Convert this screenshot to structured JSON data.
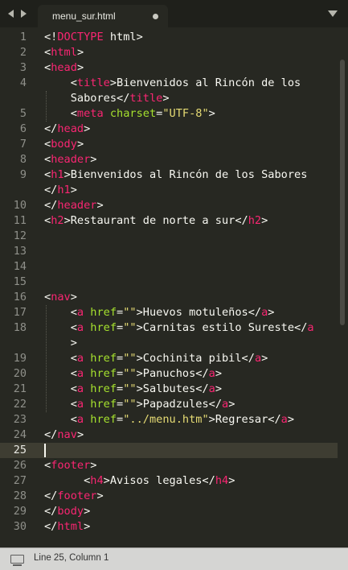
{
  "tab": {
    "filename": "menu_sur.html",
    "modified": true
  },
  "icons": {
    "nav_left": "arrow-left-icon",
    "nav_right": "arrow-right-icon",
    "tab_dirty": "unsaved-dot-icon",
    "dropdown": "chevron-down-icon",
    "status": "console-icon"
  },
  "colors": {
    "background": "#272822",
    "tag": "#f92672",
    "attribute": "#a6e22e",
    "string": "#e6db74",
    "text": "#f8f8f2",
    "line_highlight": "#3e3d32"
  },
  "editor": {
    "active_line": 25,
    "lines": [
      {
        "n": "1",
        "code": [
          [
            "t",
            "<!"
          ],
          [
            "k",
            "DOCTYPE"
          ],
          [
            "t",
            " html>"
          ]
        ]
      },
      {
        "n": "2",
        "code": [
          [
            "t",
            "<"
          ],
          [
            "k",
            "html"
          ],
          [
            "t",
            ">"
          ]
        ]
      },
      {
        "n": "3",
        "code": [
          [
            "t",
            "<"
          ],
          [
            "k",
            "head"
          ],
          [
            "t",
            ">"
          ]
        ]
      },
      {
        "n": "4",
        "code": [
          [
            "t",
            "    <"
          ],
          [
            "k",
            "title"
          ],
          [
            "t",
            ">Bienvenidos al Rincón de los"
          ]
        ]
      },
      {
        "n": "",
        "code": [
          [
            "t",
            "    Sabores</"
          ],
          [
            "k",
            "title"
          ],
          [
            "t",
            ">"
          ]
        ]
      },
      {
        "n": "5",
        "code": [
          [
            "t",
            "    <"
          ],
          [
            "k",
            "meta"
          ],
          [
            "t",
            " "
          ],
          [
            "a",
            "charset"
          ],
          [
            "t",
            "="
          ],
          [
            "s",
            "\"UTF-8\""
          ],
          [
            "t",
            ">"
          ]
        ]
      },
      {
        "n": "6",
        "code": [
          [
            "t",
            "</"
          ],
          [
            "k",
            "head"
          ],
          [
            "t",
            ">"
          ]
        ]
      },
      {
        "n": "7",
        "code": [
          [
            "t",
            "<"
          ],
          [
            "k",
            "body"
          ],
          [
            "t",
            ">"
          ]
        ]
      },
      {
        "n": "8",
        "code": [
          [
            "t",
            "<"
          ],
          [
            "k",
            "header"
          ],
          [
            "t",
            ">"
          ]
        ]
      },
      {
        "n": "9",
        "code": [
          [
            "t",
            "<"
          ],
          [
            "k",
            "h1"
          ],
          [
            "t",
            ">Bienvenidos al Rincón de los Sabores"
          ]
        ]
      },
      {
        "n": "",
        "code": [
          [
            "t",
            "</"
          ],
          [
            "k",
            "h1"
          ],
          [
            "t",
            ">"
          ]
        ]
      },
      {
        "n": "10",
        "code": [
          [
            "t",
            "</"
          ],
          [
            "k",
            "header"
          ],
          [
            "t",
            ">"
          ]
        ]
      },
      {
        "n": "11",
        "code": [
          [
            "t",
            "<"
          ],
          [
            "k",
            "h2"
          ],
          [
            "t",
            ">Restaurant de norte a sur</"
          ],
          [
            "k",
            "h2"
          ],
          [
            "t",
            ">"
          ]
        ]
      },
      {
        "n": "12",
        "code": []
      },
      {
        "n": "13",
        "code": []
      },
      {
        "n": "14",
        "code": []
      },
      {
        "n": "15",
        "code": []
      },
      {
        "n": "16",
        "code": [
          [
            "t",
            "<"
          ],
          [
            "k",
            "nav"
          ],
          [
            "t",
            ">"
          ]
        ]
      },
      {
        "n": "17",
        "code": [
          [
            "t",
            "    <"
          ],
          [
            "k",
            "a"
          ],
          [
            "t",
            " "
          ],
          [
            "a",
            "href"
          ],
          [
            "t",
            "="
          ],
          [
            "s",
            "\"\""
          ],
          [
            "t",
            ">Huevos motuleños</"
          ],
          [
            "k",
            "a"
          ],
          [
            "t",
            ">"
          ]
        ]
      },
      {
        "n": "18",
        "code": [
          [
            "t",
            "    <"
          ],
          [
            "k",
            "a"
          ],
          [
            "t",
            " "
          ],
          [
            "a",
            "href"
          ],
          [
            "t",
            "="
          ],
          [
            "s",
            "\"\""
          ],
          [
            "t",
            ">Carnitas estilo Sureste</"
          ],
          [
            "k",
            "a"
          ]
        ]
      },
      {
        "n": "",
        "code": [
          [
            "t",
            "    >"
          ]
        ]
      },
      {
        "n": "19",
        "code": [
          [
            "t",
            "    <"
          ],
          [
            "k",
            "a"
          ],
          [
            "t",
            " "
          ],
          [
            "a",
            "href"
          ],
          [
            "t",
            "="
          ],
          [
            "s",
            "\"\""
          ],
          [
            "t",
            ">Cochinita pibil</"
          ],
          [
            "k",
            "a"
          ],
          [
            "t",
            ">"
          ]
        ]
      },
      {
        "n": "20",
        "code": [
          [
            "t",
            "    <"
          ],
          [
            "k",
            "a"
          ],
          [
            "t",
            " "
          ],
          [
            "a",
            "href"
          ],
          [
            "t",
            "="
          ],
          [
            "s",
            "\"\""
          ],
          [
            "t",
            ">Panuchos</"
          ],
          [
            "k",
            "a"
          ],
          [
            "t",
            ">"
          ]
        ]
      },
      {
        "n": "21",
        "code": [
          [
            "t",
            "    <"
          ],
          [
            "k",
            "a"
          ],
          [
            "t",
            " "
          ],
          [
            "a",
            "href"
          ],
          [
            "t",
            "="
          ],
          [
            "s",
            "\"\""
          ],
          [
            "t",
            ">Salbutes</"
          ],
          [
            "k",
            "a"
          ],
          [
            "t",
            ">"
          ]
        ]
      },
      {
        "n": "22",
        "code": [
          [
            "t",
            "    <"
          ],
          [
            "k",
            "a"
          ],
          [
            "t",
            " "
          ],
          [
            "a",
            "href"
          ],
          [
            "t",
            "="
          ],
          [
            "s",
            "\"\""
          ],
          [
            "t",
            ">Papadzules</"
          ],
          [
            "k",
            "a"
          ],
          [
            "t",
            ">"
          ]
        ]
      },
      {
        "n": "23",
        "code": [
          [
            "t",
            "    <"
          ],
          [
            "k",
            "a"
          ],
          [
            "t",
            " "
          ],
          [
            "a",
            "href"
          ],
          [
            "t",
            "="
          ],
          [
            "s",
            "\"../menu.htm\""
          ],
          [
            "t",
            ">Regresar</"
          ],
          [
            "k",
            "a"
          ],
          [
            "t",
            ">"
          ]
        ]
      },
      {
        "n": "24",
        "code": [
          [
            "t",
            "</"
          ],
          [
            "k",
            "nav"
          ],
          [
            "t",
            ">"
          ]
        ]
      },
      {
        "n": "25",
        "code": [],
        "active": true
      },
      {
        "n": "26",
        "code": [
          [
            "t",
            "<"
          ],
          [
            "k",
            "footer"
          ],
          [
            "t",
            ">"
          ]
        ]
      },
      {
        "n": "27",
        "code": [
          [
            "t",
            "      <"
          ],
          [
            "k",
            "h4"
          ],
          [
            "t",
            ">Avisos legales</"
          ],
          [
            "k",
            "h4"
          ],
          [
            "t",
            ">"
          ]
        ]
      },
      {
        "n": "28",
        "code": [
          [
            "t",
            "</"
          ],
          [
            "k",
            "footer"
          ],
          [
            "t",
            ">"
          ]
        ]
      },
      {
        "n": "29",
        "code": [
          [
            "t",
            "</"
          ],
          [
            "k",
            "body"
          ],
          [
            "t",
            ">"
          ]
        ]
      },
      {
        "n": "30",
        "code": [
          [
            "t",
            "</"
          ],
          [
            "k",
            "html"
          ],
          [
            "t",
            ">"
          ]
        ]
      }
    ]
  },
  "status": {
    "position": "Line 25, Column 1"
  }
}
